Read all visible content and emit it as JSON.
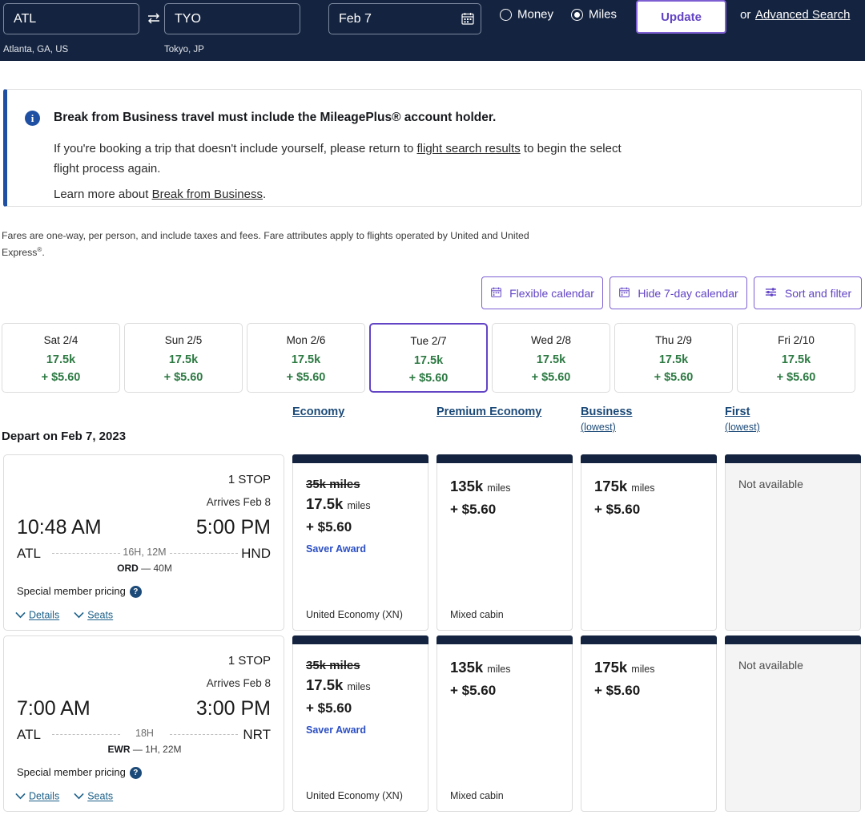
{
  "searchbar": {
    "origin": {
      "value": "ATL",
      "placeholder": "From",
      "sub": "Atlanta, GA, US"
    },
    "destination": {
      "value": "TYO",
      "placeholder": "To",
      "sub": "Tokyo, JP"
    },
    "date": {
      "value": "Feb 7",
      "placeholder": "Depart"
    },
    "swap_icon": "swap-arrows-icon",
    "calendar_icon": "calendar-icon",
    "money_label": "Money",
    "miles_label": "Miles",
    "selected_currency": "Miles",
    "update_label": "Update",
    "or_label": "or",
    "advanced_search_label": "Advanced Search",
    "bg_color": "#14233f",
    "accent_color": "#6244c5"
  },
  "banner": {
    "icon": "info-icon",
    "icon_glyph": "i",
    "title": "Break from Business travel must include the MileagePlus® account holder.",
    "body_pre": "If you're booking a trip that doesn't include yourself, please return to ",
    "body_link": "flight search results",
    "body_post": " to begin the select flight process again.",
    "learn_pre": "Learn more about ",
    "learn_link": "Break from Business",
    "learn_post": ".",
    "accent_color": "#1f4fa3"
  },
  "fare_note": {
    "line1": "Fares are one-way, per person, and include taxes and fees. Fare attributes apply to flights operated by United and United",
    "line2": "Express",
    "sup": "®",
    "line2_post": "."
  },
  "toolbar": {
    "flexible_calendar": {
      "label": "Flexible calendar",
      "icon": "calendar-icon"
    },
    "hide_7day_calendar": {
      "label": "Hide 7-day calendar",
      "icon": "calendar-icon"
    },
    "sort_and_filter": {
      "label": "Sort and filter",
      "icon": "sliders-icon"
    }
  },
  "day_strip": [
    {
      "label": "Sat 2/4",
      "miles": "17.5k",
      "price": "+ $5.60",
      "selected": false
    },
    {
      "label": "Sun 2/5",
      "miles": "17.5k",
      "price": "+ $5.60",
      "selected": false
    },
    {
      "label": "Mon 2/6",
      "miles": "17.5k",
      "price": "+ $5.60",
      "selected": false
    },
    {
      "label": "Tue 2/7",
      "miles": "17.5k",
      "price": "+ $5.60",
      "selected": true
    },
    {
      "label": "Wed 2/8",
      "miles": "17.5k",
      "price": "+ $5.60",
      "selected": false
    },
    {
      "label": "Thu 2/9",
      "miles": "17.5k",
      "price": "+ $5.60",
      "selected": false
    },
    {
      "label": "Fri 2/10",
      "miles": "17.5k",
      "price": "+ $5.60",
      "selected": false
    }
  ],
  "cabin_headers": [
    {
      "label": "Economy",
      "sub": ""
    },
    {
      "label": "Premium Economy",
      "sub": ""
    },
    {
      "label": "Business",
      "sub": "(lowest)"
    },
    {
      "label": "First",
      "sub": "(lowest)"
    }
  ],
  "depart_heading": "Depart on Feb 7, 2023",
  "flights": [
    {
      "stops": "1 STOP",
      "arrives": "Arrives Feb 8",
      "depart_time": "10:48 AM",
      "arrive_time": "5:00 PM",
      "depart_code": "ATL",
      "arrive_code": "HND",
      "duration": "16H, 12M",
      "layover_code": "ORD",
      "layover_sep": "—",
      "layover_time": "40M",
      "special_pricing": "Special member pricing",
      "help_glyph": "?",
      "details_label": "Details",
      "seats_label": "Seats",
      "fares": [
        {
          "available": true,
          "strike": "35k miles",
          "miles": "17.5k",
          "unit": "miles",
          "price": "+ $5.60",
          "tag": "Saver Award",
          "cabin": "United Economy (XN)"
        },
        {
          "available": true,
          "strike": "",
          "miles": "135k",
          "unit": "miles",
          "price": "+ $5.60",
          "tag": "",
          "cabin": "Mixed cabin"
        },
        {
          "available": true,
          "strike": "",
          "miles": "175k",
          "unit": "miles",
          "price": "+ $5.60",
          "tag": "",
          "cabin": ""
        },
        {
          "available": false,
          "na_label": "Not available"
        }
      ]
    },
    {
      "stops": "1 STOP",
      "arrives": "Arrives Feb 8",
      "depart_time": "7:00 AM",
      "arrive_time": "3:00 PM",
      "depart_code": "ATL",
      "arrive_code": "NRT",
      "duration": "18H",
      "layover_code": "EWR",
      "layover_sep": "—",
      "layover_time": "1H, 22M",
      "special_pricing": "Special member pricing",
      "help_glyph": "?",
      "details_label": "Details",
      "seats_label": "Seats",
      "fares": [
        {
          "available": true,
          "strike": "35k miles",
          "miles": "17.5k",
          "unit": "miles",
          "price": "+ $5.60",
          "tag": "Saver Award",
          "cabin": "United Economy (XN)"
        },
        {
          "available": true,
          "strike": "",
          "miles": "135k",
          "unit": "miles",
          "price": "+ $5.60",
          "tag": "",
          "cabin": "Mixed cabin"
        },
        {
          "available": true,
          "strike": "",
          "miles": "175k",
          "unit": "miles",
          "price": "+ $5.60",
          "tag": "",
          "cabin": ""
        },
        {
          "available": false,
          "na_label": "Not available"
        }
      ]
    }
  ]
}
